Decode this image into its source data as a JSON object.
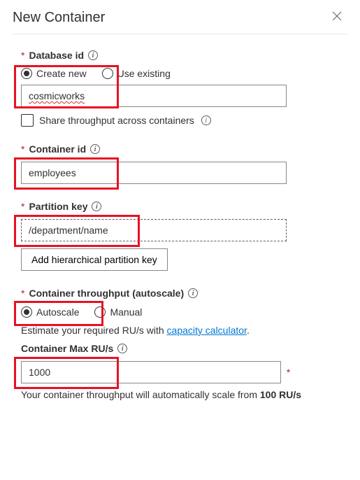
{
  "header": {
    "title": "New Container"
  },
  "fields": {
    "database": {
      "label": "Database id",
      "options": {
        "create": "Create new",
        "existing": "Use existing"
      },
      "value": "cosmicworks",
      "share": "Share throughput across containers"
    },
    "container": {
      "label": "Container id",
      "value": "employees"
    },
    "partition": {
      "label": "Partition key",
      "value": "/department/name",
      "addBtn": "Add hierarchical partition key"
    },
    "throughput": {
      "label": "Container throughput (autoscale)",
      "options": {
        "auto": "Autoscale",
        "manual": "Manual"
      },
      "estimate_prefix": "Estimate your required RU/s with ",
      "estimate_link": "capacity calculator",
      "estimate_suffix": "."
    },
    "maxru": {
      "label": "Container Max RU/s",
      "value": "1000",
      "foot_prefix": "Your container throughput will automatically scale from ",
      "foot_bold": "100 RU/s"
    }
  }
}
